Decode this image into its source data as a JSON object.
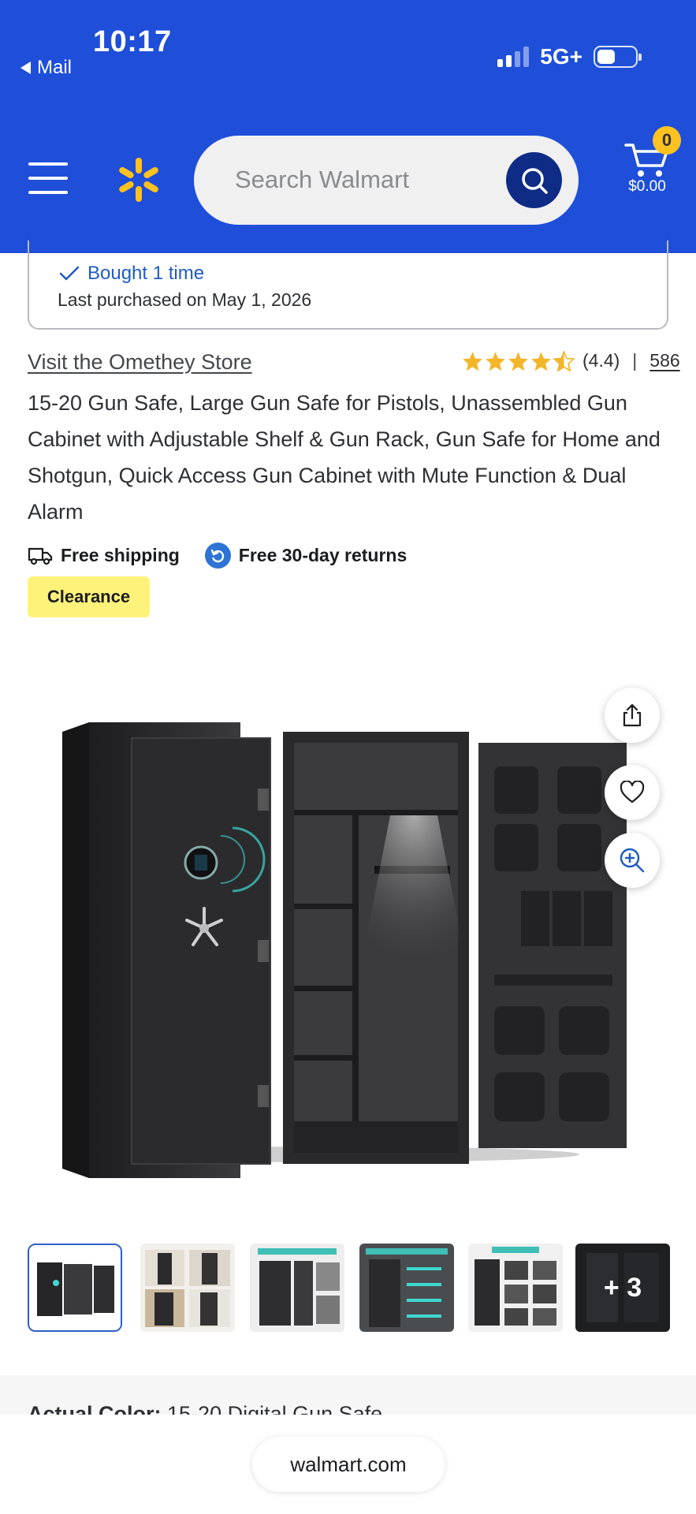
{
  "status_bar": {
    "time": "10:17",
    "back_label": "Mail",
    "network": "5G+"
  },
  "header": {
    "search": {
      "placeholder": "Search Walmart"
    },
    "cart": {
      "count": "0",
      "total": "$0.00"
    },
    "colors": {
      "background": "#1f4fd9",
      "spark": "#ffc220",
      "search_button": "#0e2c85"
    }
  },
  "purchase_history": {
    "bought": "Bought 1 time",
    "last_purchased": "Last purchased on May 1, 2026"
  },
  "product": {
    "store_link": "Visit the Omethey Store",
    "rating_value": 4.4,
    "rating_text": "(4.4)",
    "separator": "|",
    "review_count": "586",
    "title": "15-20 Gun Safe, Large Gun Safe for Pistols, Unassembled Gun Cabinet with Adjustable Shelf & Gun Rack, Gun Safe for Home and Shotgun, Quick Access Gun Cabinet with Mute Function & Dual Alarm",
    "perks": {
      "shipping": "Free shipping",
      "returns": "Free 30-day returns"
    },
    "badge": "Clearance",
    "image_actions": [
      "share-icon",
      "heart-icon",
      "zoom-in-icon"
    ],
    "thumbnails": {
      "count_visible": 6,
      "more_label": "+ 3"
    },
    "actual_color_label": "Actual Color:",
    "actual_color_value": "15-20 Digital Gun Safe"
  },
  "browser": {
    "url": "walmart.com"
  }
}
